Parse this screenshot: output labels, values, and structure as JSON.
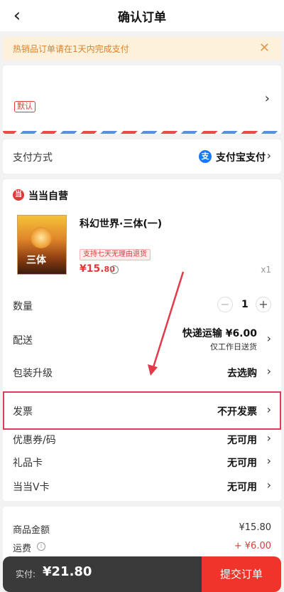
{
  "header": {
    "title": "确认订单",
    "back_icon": "‹"
  },
  "notice": {
    "text": "热销品订单请在1天内完成支付",
    "close_icon": "✕"
  },
  "address": {
    "default_tag": "默认",
    "chevron": "›"
  },
  "payment": {
    "label": "支付方式",
    "method": "支付宝支付",
    "icon_glyph": "支",
    "chevron": "›"
  },
  "store": {
    "icon_glyph": "当",
    "name": "当当自营"
  },
  "product": {
    "cover_title": "三体",
    "name": "科幻世界·三体(一)",
    "return_tag": "支持七天无理由退货",
    "price_main": "¥15.",
    "price_cents": "80",
    "quantity_mark": "x1"
  },
  "rows": {
    "quantity": {
      "label": "数量",
      "value": "1",
      "minus": "−",
      "plus": "+"
    },
    "delivery": {
      "label": "配送",
      "value": "快递运输 ¥6.00",
      "sub": "仅工作日送货"
    },
    "packaging": {
      "label": "包装升级",
      "value": "去选购"
    },
    "invoice": {
      "label": "发票",
      "value": "不开发票"
    },
    "coupon": {
      "label": "优惠券/码",
      "value": "无可用"
    },
    "giftcard": {
      "label": "礼品卡",
      "value": "无可用"
    },
    "vcard": {
      "label": "当当V卡",
      "value": "无可用"
    }
  },
  "summary": {
    "goods_label": "商品金额",
    "goods_value": "¥15.80",
    "freight_label": "运费",
    "freight_value": "+ ¥6.00"
  },
  "footer": {
    "pay_label": "实付:",
    "pay_amount": "¥21.80",
    "submit_label": "提交订单"
  },
  "colors": {
    "accent": "#f0342c",
    "highlight_box": "#e23a5a"
  }
}
